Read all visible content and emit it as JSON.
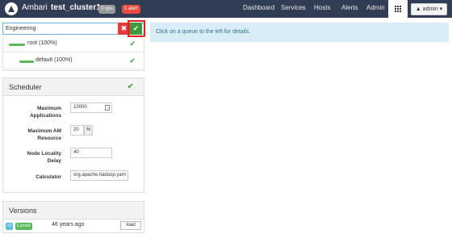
{
  "navbar": {
    "brand": "Ambari",
    "cluster_name": "test_cluster1",
    "ops_badge": "0 ops",
    "alert_badge": "1 alert",
    "items": [
      "Dashboard",
      "Services",
      "Hosts",
      "Alerts",
      "Admin"
    ],
    "user_menu": "▲ admin ▾",
    "icons": {
      "logo": "ambari-logo-icon",
      "apps": "grid-icon",
      "user": "user-icon"
    }
  },
  "queue_search": {
    "value": "Engineering",
    "cancel_label": "✖",
    "confirm_label": "✔"
  },
  "queues": [
    {
      "label": "root (100%)",
      "status": "✔"
    },
    {
      "label": "default (100%)",
      "status": "✔"
    }
  ],
  "scheduler": {
    "title": "Scheduler",
    "status": "✔",
    "fields": {
      "max_apps": {
        "label": "Maximum Applications",
        "value": "10000",
        "spinner": "↕"
      },
      "max_am": {
        "label": "Maximum AM Resource",
        "value": "20",
        "unit": "%"
      },
      "node_locality": {
        "label": "Node Locality Delay",
        "value": "40"
      },
      "calculator": {
        "label": "Calculator",
        "value": "org.apache.hadoop.yarn"
      }
    }
  },
  "versions": {
    "title": "Versions",
    "rows": [
      {
        "version_tag": "v1",
        "current_tag": "Current",
        "time": "46 years ago",
        "action": "load"
      }
    ]
  },
  "info_message": "Click on a queue to the left for details.",
  "colors": {
    "navbar": "#313d54",
    "success": "#5cb85c",
    "danger": "#e53b3b",
    "info_bg": "#d9edf7",
    "info_text": "#31708f"
  }
}
